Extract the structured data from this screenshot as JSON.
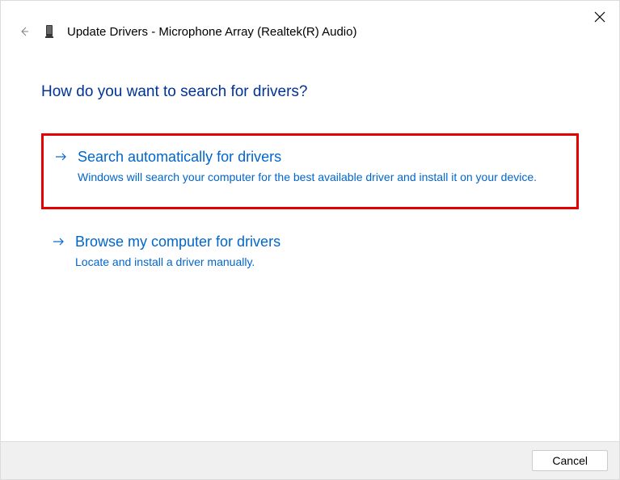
{
  "header": {
    "title": "Update Drivers - Microphone Array (Realtek(R) Audio)"
  },
  "content": {
    "question": "How do you want to search for drivers?",
    "options": [
      {
        "title": "Search automatically for drivers",
        "description": "Windows will search your computer for the best available driver and install it on your device."
      },
      {
        "title": "Browse my computer for drivers",
        "description": "Locate and install a driver manually."
      }
    ]
  },
  "footer": {
    "cancel_label": "Cancel"
  }
}
